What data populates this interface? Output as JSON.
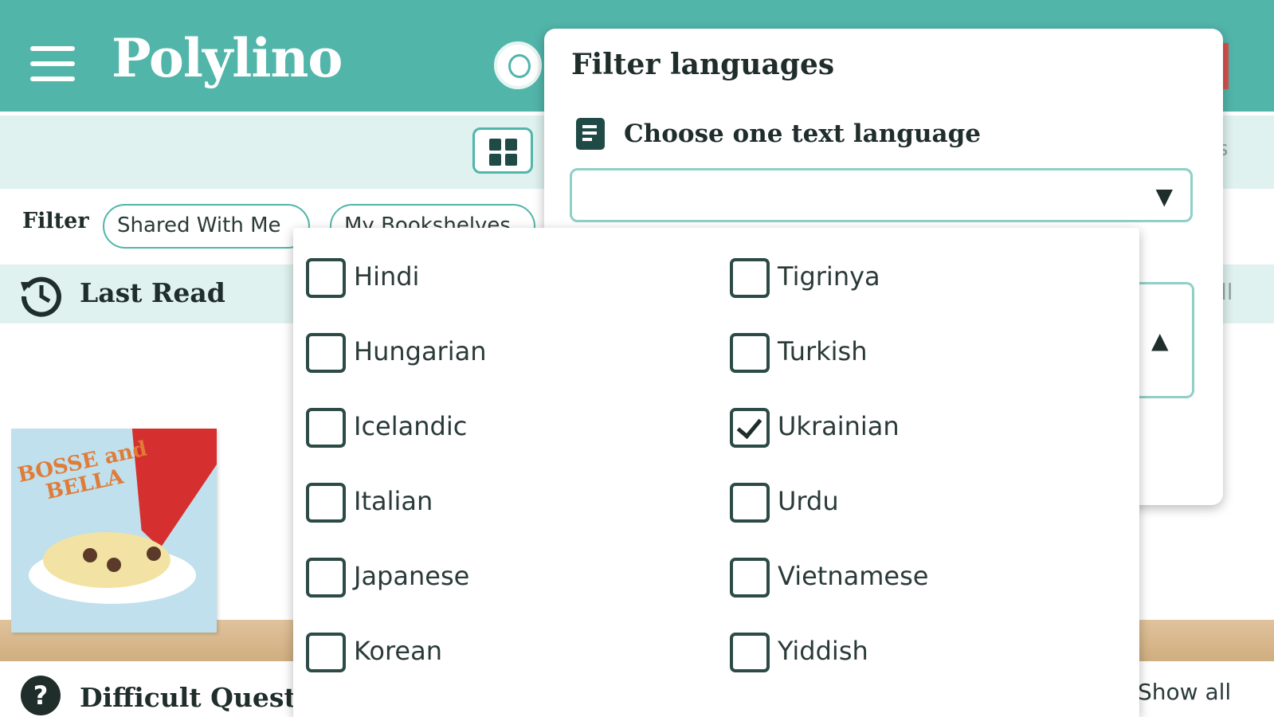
{
  "header": {
    "app_name": "Polylino",
    "menu_icon": "hamburger-menu-icon",
    "avatar_icon": "child-face-icon",
    "background_color": "#52b5aa"
  },
  "toolbar": {
    "view_toggle_icon": "grid-view-icon",
    "edge_text": "s"
  },
  "filter_bar": {
    "label": "Filter",
    "chips": [
      "Shared With Me",
      "My Bookshelves"
    ]
  },
  "sections": {
    "last_read": {
      "title": "Last Read",
      "icon": "history-clock-icon",
      "edge_text": "ll"
    },
    "difficult_questions": {
      "title": "Difficult Quest",
      "icon": "question-icon",
      "show_all": "Show all"
    }
  },
  "book": {
    "cover_title_line1": "BOSSE and",
    "cover_title_line2": "BELLA"
  },
  "filter_panel": {
    "title": "Filter languages",
    "text_language_label": "Choose one text language",
    "text_language_icon": "document-icon",
    "select_value": "",
    "select_arrow": "▼",
    "second_select_arrow": "▲"
  },
  "language_options": {
    "left": [
      {
        "label": "Hindi",
        "checked": false
      },
      {
        "label": "Hungarian",
        "checked": false
      },
      {
        "label": "Icelandic",
        "checked": false
      },
      {
        "label": "Italian",
        "checked": false
      },
      {
        "label": "Japanese",
        "checked": false
      },
      {
        "label": "Korean",
        "checked": false
      }
    ],
    "right": [
      {
        "label": "Tigrinya",
        "checked": false
      },
      {
        "label": "Turkish",
        "checked": false
      },
      {
        "label": "Ukrainian",
        "checked": true
      },
      {
        "label": "Urdu",
        "checked": false
      },
      {
        "label": "Vietnamese",
        "checked": false
      },
      {
        "label": "Yiddish",
        "checked": false
      }
    ]
  }
}
